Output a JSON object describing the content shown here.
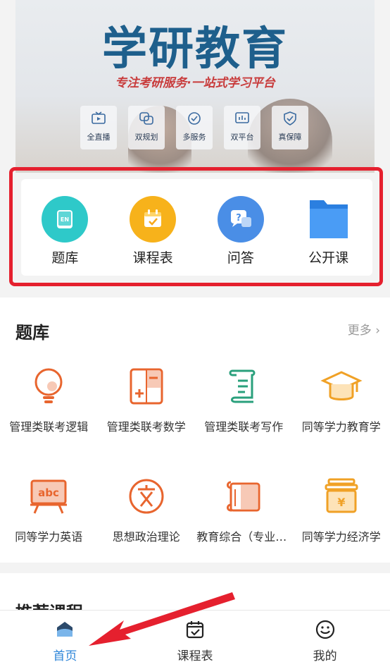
{
  "banner": {
    "title": "学研教育",
    "subtitle": "专注考研服务·一站式学习平台",
    "features": [
      {
        "label": "全直播",
        "icon": "tv-icon"
      },
      {
        "label": "双规划",
        "icon": "layers-icon"
      },
      {
        "label": "多服务",
        "icon": "check-circle-icon"
      },
      {
        "label": "双平台",
        "icon": "chart-screen-icon"
      },
      {
        "label": "真保障",
        "icon": "shield-check-icon"
      }
    ]
  },
  "quick_entry": [
    {
      "label": "题库",
      "icon": "question-bank-icon",
      "color": "#2ec9c9"
    },
    {
      "label": "课程表",
      "icon": "calendar-icon",
      "color": "#f7b21b"
    },
    {
      "label": "问答",
      "icon": "qa-bubble-icon",
      "color": "#4a8ee6"
    },
    {
      "label": "公开课",
      "icon": "folder-icon",
      "color": "#3a8df0"
    }
  ],
  "question_bank": {
    "title": "题库",
    "more": "更多 ›",
    "items": [
      {
        "label": "管理类联考逻辑",
        "icon": "lightbulb-icon"
      },
      {
        "label": "管理类联考数学",
        "icon": "calculator-icon"
      },
      {
        "label": "管理类联考写作",
        "icon": "scroll-icon"
      },
      {
        "label": "同等学力教育学",
        "icon": "graduation-cap-icon"
      },
      {
        "label": "同等学力英语",
        "icon": "abc-board-icon"
      },
      {
        "label": "思想政治理论",
        "icon": "politics-icon"
      },
      {
        "label": "教育综合（专业课）",
        "icon": "book-icon"
      },
      {
        "label": "同等学力经济学",
        "icon": "yuan-box-icon"
      }
    ]
  },
  "recommended": {
    "title": "推荐课程"
  },
  "tabbar": [
    {
      "label": "首页",
      "icon": "home-icon",
      "active": true
    },
    {
      "label": "课程表",
      "icon": "calendar-check-icon",
      "active": false
    },
    {
      "label": "我的",
      "icon": "smile-icon",
      "active": false
    }
  ],
  "colors": {
    "accent": "#2b84d8",
    "highlight": "#e5202e",
    "orange": "#e8652e"
  }
}
